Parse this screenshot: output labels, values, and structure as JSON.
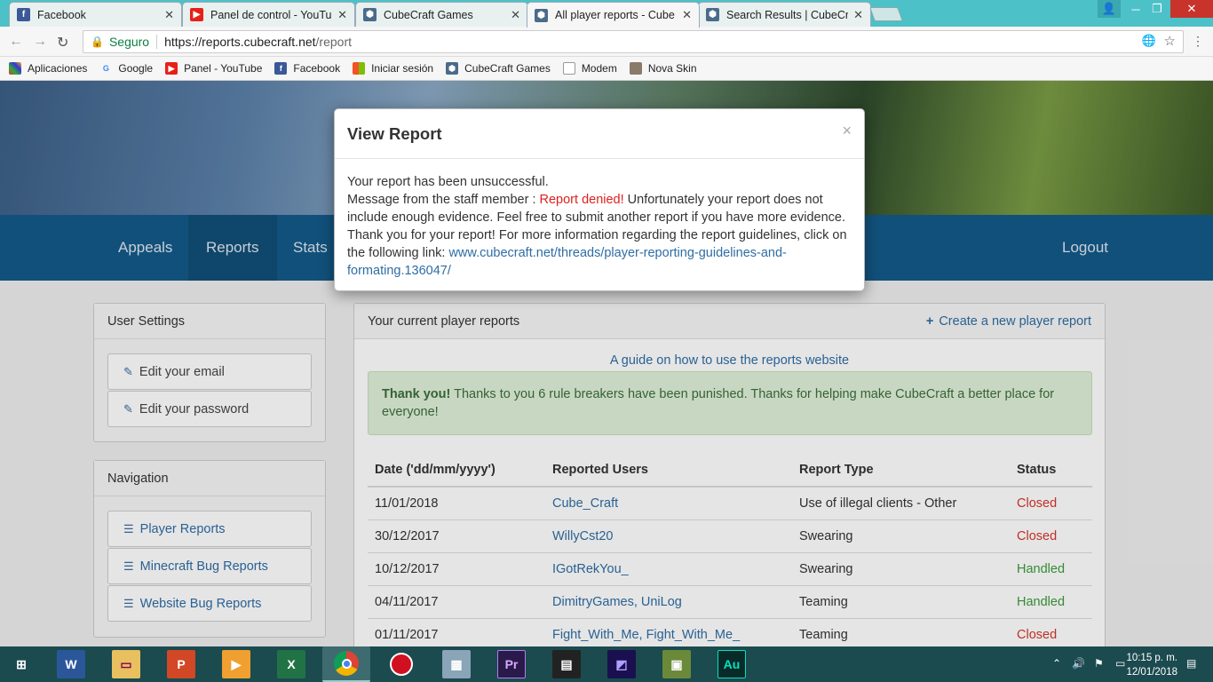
{
  "browser": {
    "tabs": [
      {
        "title": "Facebook",
        "icon": "facebook-icon",
        "color": "#3b5998"
      },
      {
        "title": "Panel de control - YouTu",
        "icon": "youtube-icon",
        "color": "#e62117"
      },
      {
        "title": "CubeCraft Games",
        "icon": "cubecraft-icon",
        "color": "#4a6b8a"
      },
      {
        "title": "All player reports - Cube",
        "icon": "cubecraft-icon",
        "color": "#4a6b8a"
      },
      {
        "title": "Search Results | CubeCra",
        "icon": "cubecraft-icon",
        "color": "#4a6b8a"
      }
    ],
    "address": {
      "secure_label": "Seguro",
      "url_host": "https://reports.cubecraft.net",
      "url_path": "/report"
    },
    "bookmarks": [
      {
        "label": "Aplicaciones",
        "icon": "apps-grid-icon"
      },
      {
        "label": "Google",
        "icon": "google-icon"
      },
      {
        "label": "Panel - YouTube",
        "icon": "youtube-icon"
      },
      {
        "label": "Facebook",
        "icon": "facebook-icon"
      },
      {
        "label": "Iniciar sesión",
        "icon": "microsoft-icon"
      },
      {
        "label": "CubeCraft Games",
        "icon": "cubecraft-icon"
      },
      {
        "label": "Modem",
        "icon": "page-icon"
      },
      {
        "label": "Nova Skin",
        "icon": "novaskin-icon"
      }
    ]
  },
  "nav": {
    "appeals": "Appeals",
    "reports": "Reports",
    "stats": "Stats",
    "logout": "Logout"
  },
  "user_settings": {
    "title": "User Settings",
    "edit_email": "Edit your email",
    "edit_password": "Edit your password"
  },
  "navigation": {
    "title": "Navigation",
    "player_reports": "Player Reports",
    "minecraft_bug_reports": "Minecraft Bug Reports",
    "website_bug_reports": "Website Bug Reports"
  },
  "main": {
    "title": "Your current player reports",
    "create_label": "Create a new player report",
    "guide_link": "A guide on how to use the reports website",
    "alert_strong": "Thank you!",
    "alert_text": " Thanks to you 6 rule breakers have been punished. Thanks for helping make CubeCraft a better place for everyone!"
  },
  "table": {
    "headers": [
      "Date ('dd/mm/yyyy')",
      "Reported Users",
      "Report Type",
      "Status"
    ],
    "rows": [
      {
        "date": "11/01/2018",
        "users": "Cube_Craft",
        "type": "Use of illegal clients - Other",
        "status": "Closed"
      },
      {
        "date": "30/12/2017",
        "users": "WillyCst20",
        "type": "Swearing",
        "status": "Closed"
      },
      {
        "date": "10/12/2017",
        "users": "IGotRekYou_",
        "type": "Swearing",
        "status": "Handled"
      },
      {
        "date": "04/11/2017",
        "users": "DimitryGames, UniLog",
        "type": "Teaming",
        "status": "Handled"
      },
      {
        "date": "01/11/2017",
        "users": "Fight_With_Me, Fight_With_Me_",
        "type": "Teaming",
        "status": "Closed"
      }
    ]
  },
  "modal": {
    "title": "View Report",
    "close": "×",
    "line1": "Your report has been unsuccessful.",
    "msg_prefix": "Message from the staff member : ",
    "msg_red": "Report denied!",
    "msg_body": " Unfortunately your report does not include enough evidence. Feel free to submit another report if you have more evidence. Thank you for your report! For more information regarding the report guidelines, click on the following link: ",
    "msg_link": "www.cubecraft.net/threads/player-reporting-guidelines-and-formating.136047/"
  },
  "taskbar": {
    "time": "10:15 p. m.",
    "date": "12/01/2018"
  }
}
